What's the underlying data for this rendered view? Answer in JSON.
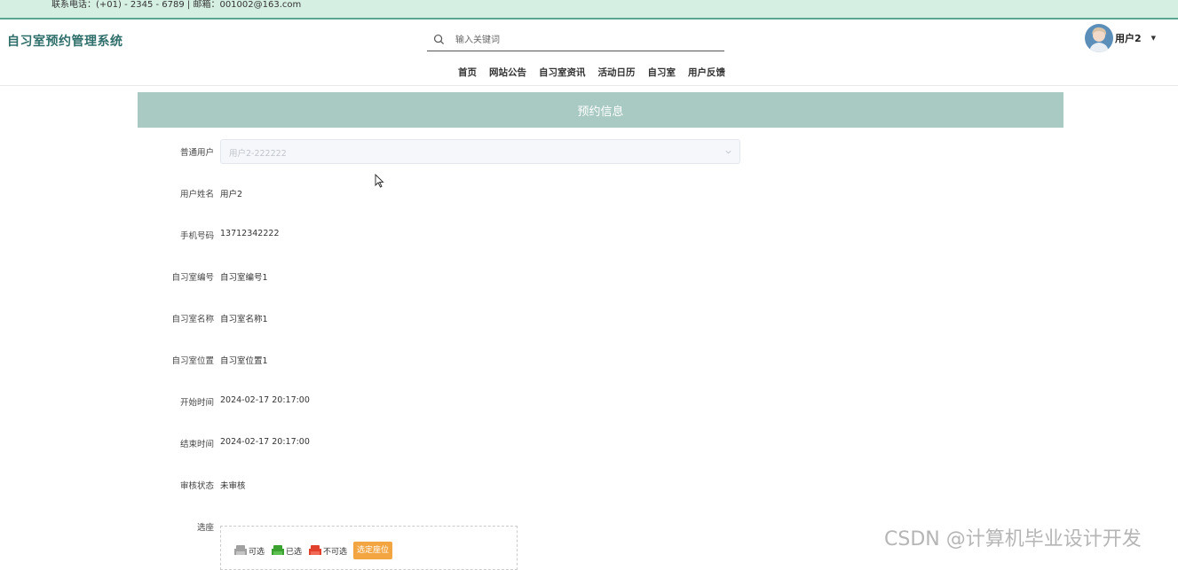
{
  "topbar": {
    "contact": "联系电话：(+01) - 2345 - 6789  |  邮箱：001002@163.com"
  },
  "header": {
    "site_title": "自习室预约管理系统",
    "search_placeholder": "输入关键词",
    "user_name": "用户2",
    "nav": [
      "首页",
      "网站公告",
      "自习室资讯",
      "活动日历",
      "自习室",
      "用户反馈"
    ]
  },
  "banner": {
    "title": "预约信息"
  },
  "form": {
    "user_select": {
      "label": "普通用户",
      "value": "用户2-222222"
    },
    "fields": [
      {
        "label": "用户姓名",
        "value": "用户2"
      },
      {
        "label": "手机号码",
        "value": "13712342222"
      },
      {
        "label": "自习室编号",
        "value": "自习室编号1"
      },
      {
        "label": "自习室名称",
        "value": "自习室名称1"
      },
      {
        "label": "自习室位置",
        "value": "自习室位置1"
      },
      {
        "label": "开始时间",
        "value": "2024-02-17 20:17:00"
      },
      {
        "label": "结束时间",
        "value": "2024-02-17 20:17:00"
      },
      {
        "label": "审核状态",
        "value": "未审核"
      }
    ],
    "seat": {
      "label": "选座",
      "legend": [
        {
          "label": "可选",
          "color": "#a0a0a0"
        },
        {
          "label": "已选",
          "color": "#3aa02f"
        },
        {
          "label": "不可选",
          "color": "#e0402c"
        }
      ],
      "pick_button": "选定座位"
    }
  },
  "watermark": "CSDN @计算机毕业设计开发",
  "colors": {
    "topbar_bg": "#d6efe3",
    "banner_bg": "#a9c9c3",
    "title_color": "#2e6e6a",
    "button_orange": "#f2a541"
  }
}
